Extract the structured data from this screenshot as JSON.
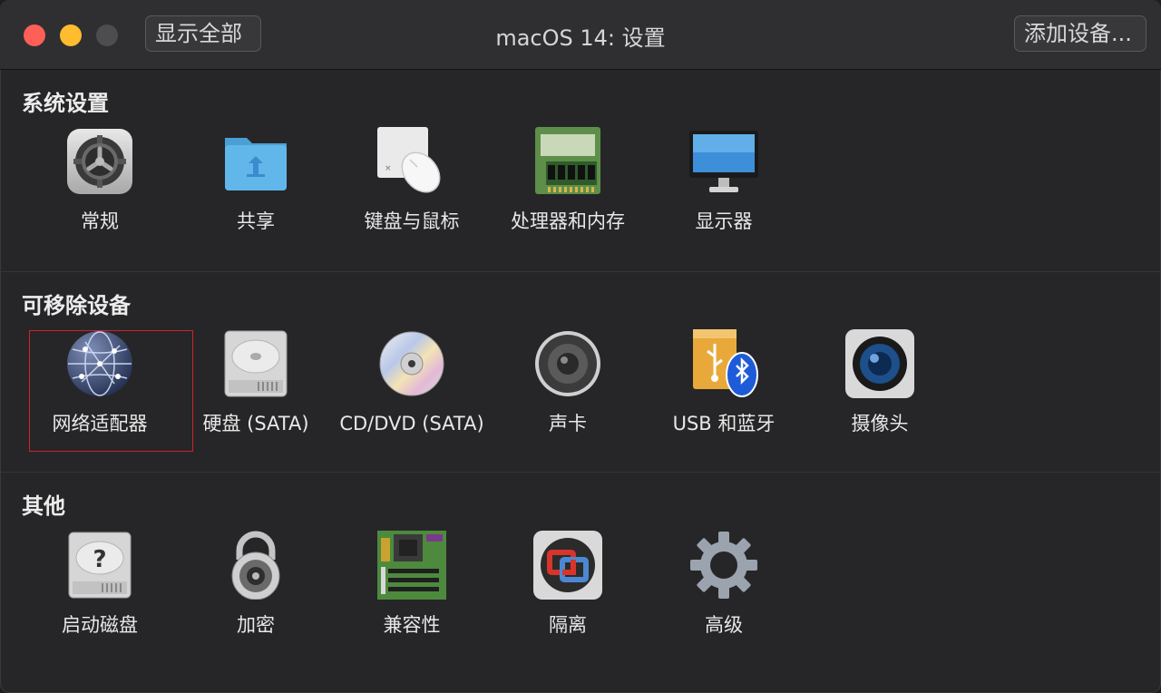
{
  "window": {
    "title": "macOS 14: 设置",
    "show_all": "显示全部",
    "add_device": "添加设备..."
  },
  "sections": {
    "system": {
      "title": "系统设置",
      "items": [
        "常规",
        "共享",
        "键盘与鼠标",
        "处理器和内存",
        "显示器"
      ]
    },
    "removable": {
      "title": "可移除设备",
      "items": [
        "网络适配器",
        "硬盘 (SATA)",
        "CD/DVD (SATA)",
        "声卡",
        "USB 和蓝牙",
        "摄像头"
      ],
      "selected": "网络适配器"
    },
    "other": {
      "title": "其他",
      "items": [
        "启动磁盘",
        "加密",
        "兼容性",
        "隔离",
        "高级"
      ]
    }
  },
  "icons": {
    "general": "gear-icon",
    "sharing": "shared-folder-icon",
    "keyboard_mouse": "keyboard-mouse-icon",
    "cpu_memory": "memory-chip-icon",
    "display": "monitor-icon",
    "network": "globe-network-icon",
    "hard_disk": "hard-disk-icon",
    "cd_dvd": "optical-disc-icon",
    "sound": "speaker-icon",
    "usb_bluetooth": "usb-bluetooth-icon",
    "camera": "camera-icon",
    "startup_disk": "startup-disk-icon",
    "encryption": "padlock-icon",
    "compatibility": "motherboard-icon",
    "isolation": "isolation-icon",
    "advanced": "advanced-gear-icon"
  },
  "colors": {
    "close": "#fe5f57",
    "minimize": "#febc2e",
    "selection_border": "#d0202a"
  }
}
